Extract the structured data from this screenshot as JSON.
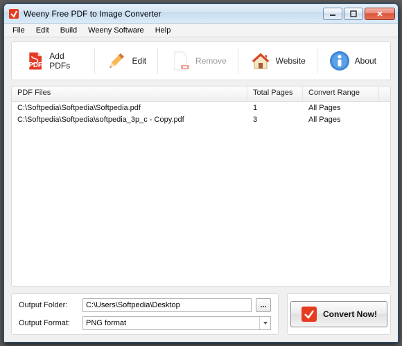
{
  "window": {
    "title": "Weeny Free PDF to Image Converter"
  },
  "menubar": {
    "file": "File",
    "edit": "Edit",
    "build": "Build",
    "weeny_software": "Weeny Software",
    "help": "Help"
  },
  "toolbar": {
    "add_pdfs": "Add PDFs",
    "edit": "Edit",
    "remove": "Remove",
    "website": "Website",
    "about": "About"
  },
  "list": {
    "header_path": "PDF Files",
    "header_pages": "Total Pages",
    "header_range": "Convert Range",
    "rows": [
      {
        "path": "C:\\Softpedia\\Softpedia\\Softpedia.pdf",
        "pages": "1",
        "range": "All Pages"
      },
      {
        "path": "C:\\Softpedia\\Softpedia\\softpedia_3p_c - Copy.pdf",
        "pages": "3",
        "range": "All Pages"
      }
    ]
  },
  "output": {
    "folder_label": "Output Folder:",
    "folder_value": "C:\\Users\\Softpedia\\Desktop",
    "browse": "...",
    "format_label": "Output Format:",
    "format_value": "PNG format"
  },
  "convert": {
    "label": "Convert Now!"
  }
}
